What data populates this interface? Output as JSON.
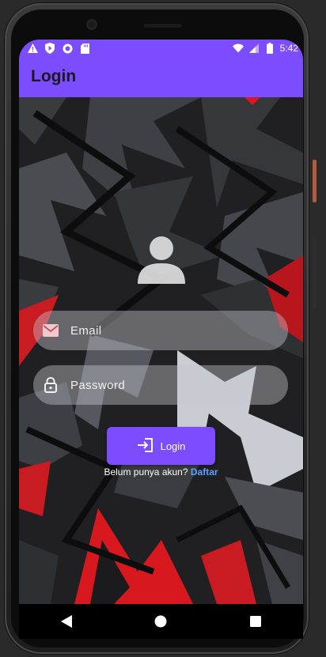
{
  "status_bar": {
    "time": "5:42",
    "left_icons": [
      "alert-triangle-icon",
      "shield-play-icon",
      "record-icon",
      "sd-card-icon"
    ],
    "right_icons": [
      "wifi-icon",
      "cellular-icon",
      "battery-icon"
    ]
  },
  "app_bar": {
    "title": "Login"
  },
  "form": {
    "email_placeholder": "Email",
    "password_placeholder": "Password",
    "login_label": "Login",
    "register_prompt": "Belum punya akun?",
    "register_link": "Daftar"
  },
  "colors": {
    "accent": "#7c4dff",
    "link": "#5aa0ff",
    "field_bg": "rgba(200,200,210,0.42)",
    "art_red": "#d8181f",
    "art_gray": "#5c5f66",
    "art_light": "#c9ccd2"
  },
  "icons": {
    "avatar": "person-icon",
    "email": "mail-icon",
    "password": "lock-icon",
    "login": "login-arrow-icon"
  },
  "navigation": {
    "back": "back-triangle-icon",
    "home": "home-circle-icon",
    "recents": "recents-square-icon"
  }
}
